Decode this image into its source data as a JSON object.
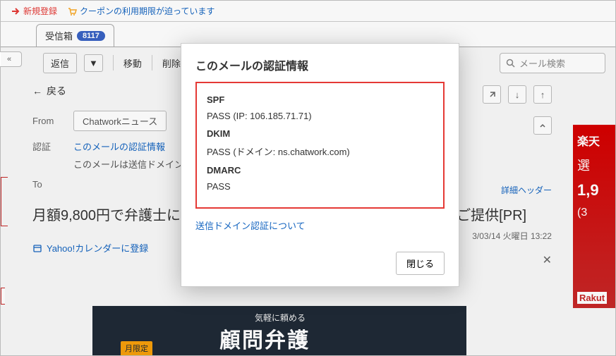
{
  "topstrip": {
    "new_reg": "新規登録",
    "coupon": "クーポンの利用期限が迫っています"
  },
  "tabs": {
    "inbox_label": "受信箱",
    "inbox_count": "8117"
  },
  "toolbar": {
    "reply": "返信",
    "move": "移動",
    "delete": "削除",
    "search_placeholder": "メール検索"
  },
  "back_label": "戻る",
  "headers": {
    "from_label": "From",
    "from_value": "Chatworkニュース",
    "auth_label": "認証",
    "auth_link": "このメールの認証情報",
    "auth_note": "このメールは送信ドメイン認",
    "to_label": "To"
  },
  "detail_header_link": "詳細ヘッダー",
  "subject_prefix": "月額9,800円で弁護士に",
  "subject_suffix": "ご提供[PR]",
  "date": "3/03/14 火曜日 13:22",
  "calendar_link": "Yahoo!カレンダーに登録",
  "ad": {
    "line1": "楽天",
    "line2": "選",
    "line3": "1,9",
    "line4": "(3",
    "brand": "Rakut"
  },
  "banner": {
    "tag": "月限定",
    "line1": "気軽に頼める",
    "line2": "顧問弁護"
  },
  "modal": {
    "title": "このメールの認証情報",
    "spf_h": "SPF",
    "spf_v": "PASS (IP: 106.185.71.71)",
    "dkim_h": "DKIM",
    "dkim_v": "PASS (ドメイン: ns.chatwork.com)",
    "dmarc_h": "DMARC",
    "dmarc_v": "PASS",
    "about_link": "送信ドメイン認証について",
    "close": "閉じる"
  }
}
